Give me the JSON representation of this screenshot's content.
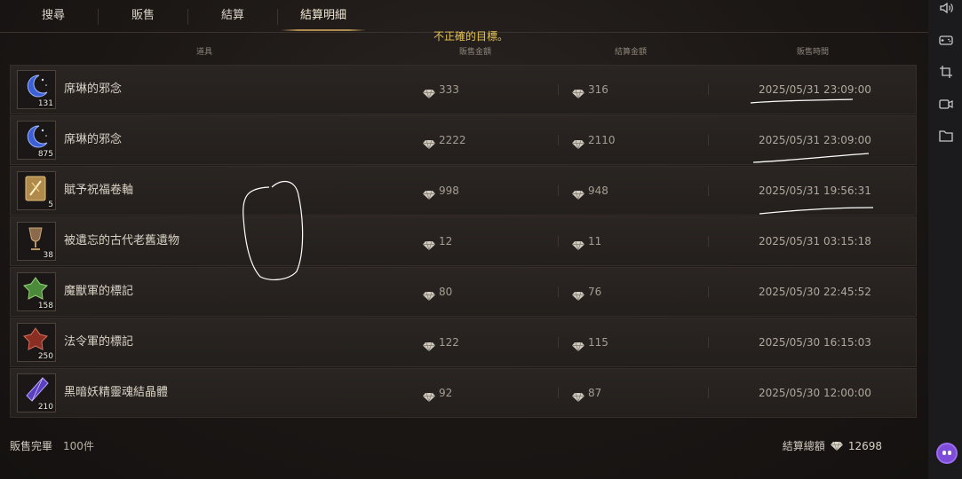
{
  "tabs": [
    {
      "label": "搜尋",
      "active": false
    },
    {
      "label": "販售",
      "active": false
    },
    {
      "label": "結算",
      "active": false
    },
    {
      "label": "結算明細",
      "active": true
    }
  ],
  "warning": "不正確的目標。",
  "columns": {
    "item": "道具",
    "sale": "販售金額",
    "settle": "結算金額",
    "time": "販售時間"
  },
  "rows": [
    {
      "name": "席琳的邪念",
      "qty": "131",
      "sale": "333",
      "settle": "316",
      "time": "2025/05/31 23:09:00",
      "icon": "blue-crescent-icon"
    },
    {
      "name": "席琳的邪念",
      "qty": "875",
      "sale": "2222",
      "settle": "2110",
      "time": "2025/05/31 23:09:00",
      "icon": "blue-crescent-icon"
    },
    {
      "name": "賦予祝福卷軸",
      "qty": "5",
      "sale": "998",
      "settle": "948",
      "time": "2025/05/31 19:56:31",
      "icon": "scroll-icon"
    },
    {
      "name": "被遺忘的古代老舊遺物",
      "qty": "38",
      "sale": "12",
      "settle": "11",
      "time": "2025/05/31 03:15:18",
      "icon": "goblet-icon"
    },
    {
      "name": "魔獸軍的標記",
      "qty": "158",
      "sale": "80",
      "settle": "76",
      "time": "2025/05/30 22:45:52",
      "icon": "green-emblem-icon"
    },
    {
      "name": "法令軍的標記",
      "qty": "250",
      "sale": "122",
      "settle": "115",
      "time": "2025/05/30 16:15:03",
      "icon": "red-emblem-icon"
    },
    {
      "name": "黑暗妖精靈魂結晶體",
      "qty": "210",
      "sale": "92",
      "settle": "87",
      "time": "2025/05/30 12:00:00",
      "icon": "purple-crystal-icon"
    }
  ],
  "footer": {
    "sold_label": "販售完畢",
    "sold_count": "100件",
    "total_label": "結算總額",
    "total_value": "12698"
  },
  "colors": {
    "accent": "#b08c50",
    "warning": "#e5c55a",
    "panel": "#231f1c"
  },
  "toolbar_icons": [
    "speaker-icon",
    "gamepad-icon",
    "crop-icon",
    "video-icon",
    "folder-icon"
  ]
}
